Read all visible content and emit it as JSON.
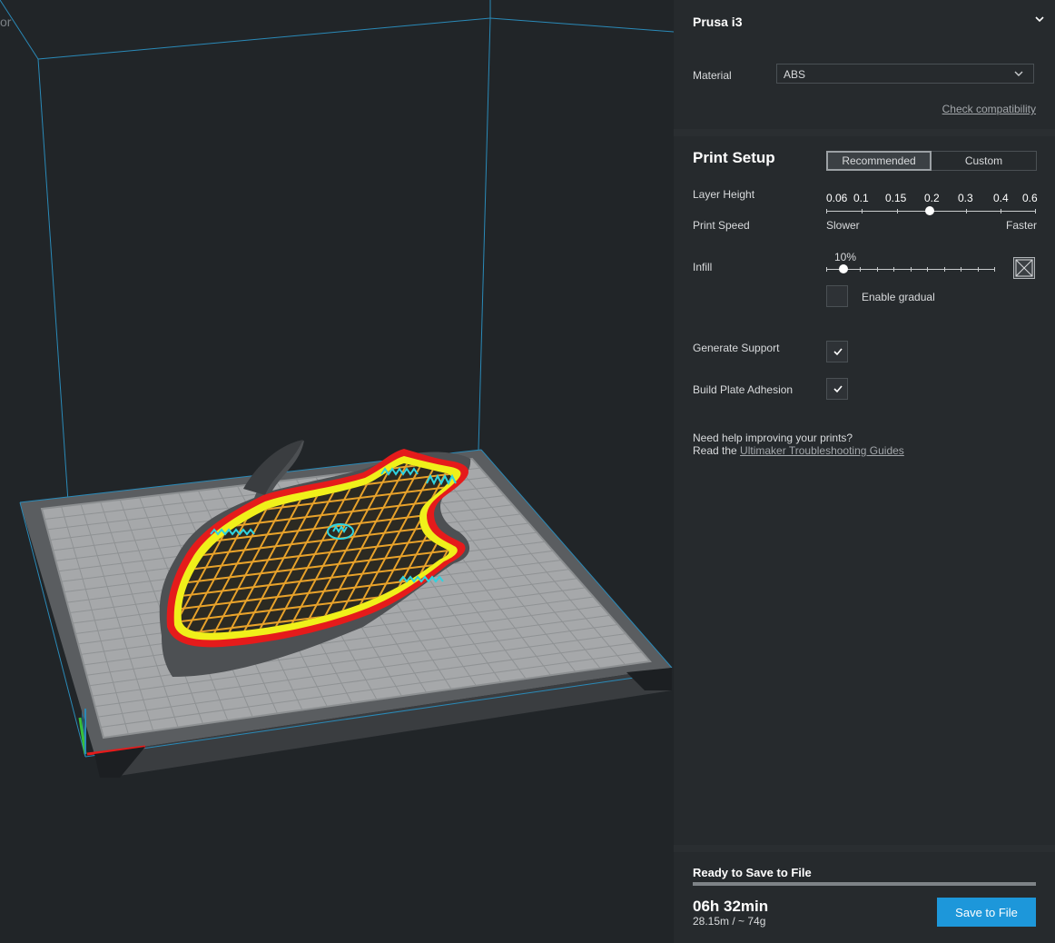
{
  "viewport": {
    "corner_text": "or"
  },
  "machine": {
    "name": "Prusa i3",
    "material_label": "Material",
    "material_value": "ABS",
    "check_compatibility": "Check compatibility"
  },
  "print_setup": {
    "title": "Print Setup",
    "mode_tabs": [
      "Recommended",
      "Custom"
    ],
    "active_mode": "Recommended",
    "layer_height_label": "Layer Height",
    "layer_height_ticks": [
      "0.06",
      "0.1",
      "0.15",
      "0.2",
      "0.3",
      "0.4",
      "0.6"
    ],
    "layer_height_selected": "0.2",
    "print_speed_label": "Print Speed",
    "print_speed_slower": "Slower",
    "print_speed_faster": "Faster",
    "infill_label": "Infill",
    "infill_value": "10%",
    "infill_fraction": 0.1,
    "enable_gradual_label": "Enable gradual",
    "enable_gradual_checked": false,
    "generate_support_label": "Generate Support",
    "generate_support_checked": true,
    "build_plate_adhesion_label": "Build Plate Adhesion",
    "build_plate_adhesion_checked": true,
    "help_line1": "Need help improving your prints?",
    "help_line2_prefix": "Read the ",
    "help_link": "Ultimaker Troubleshooting Guides"
  },
  "status": {
    "title": "Ready to Save to File",
    "progress": 1.0,
    "print_time": "06h 32min",
    "material_usage": "28.15m / ~ 74g",
    "save_button": "Save to File"
  },
  "colors": {
    "accent": "#1d97da",
    "panel_bg": "#262a2d",
    "viewport_bg": "#212528",
    "build_volume": "#2a8ab8",
    "outer_wall": "#e51b1b",
    "inner_wall": "#f0f01a",
    "infill": "#e8a22a",
    "support": "#2fd3e0",
    "skin": "#39c03a"
  }
}
